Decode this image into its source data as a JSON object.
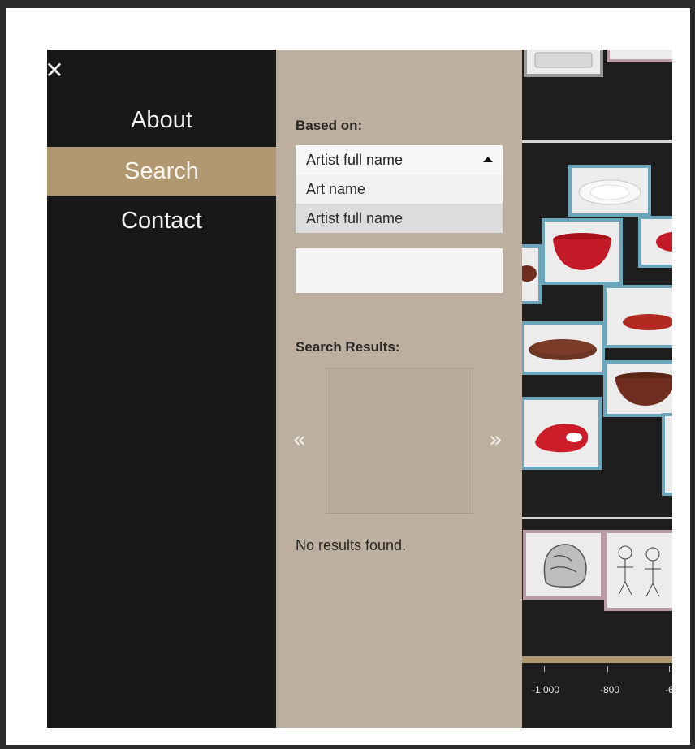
{
  "nav": {
    "close_glyph": "✕",
    "items": [
      {
        "label": "About"
      },
      {
        "label": "Search"
      },
      {
        "label": "Contact"
      }
    ]
  },
  "search": {
    "based_on_label": "Based on:",
    "selected_value": "Artist full name",
    "options": [
      "Art name",
      "Artist full name"
    ],
    "input_value": "",
    "results_label": "Search Results:",
    "prev_glyph": "«",
    "next_glyph": "»",
    "no_results_text": "No results found."
  },
  "timeline": {
    "tick_labels": [
      "-1,000",
      "-800",
      "-6"
    ]
  },
  "colors": {
    "accent": "#b29871",
    "panel": "#bcaf9f",
    "nav_bg": "#181818",
    "thumb_border": "#6aa7bd"
  },
  "icons": {
    "close": "close-icon",
    "prev": "chevron-double-left-icon",
    "next": "chevron-double-right-icon",
    "dropdown": "caret-up-icon"
  }
}
